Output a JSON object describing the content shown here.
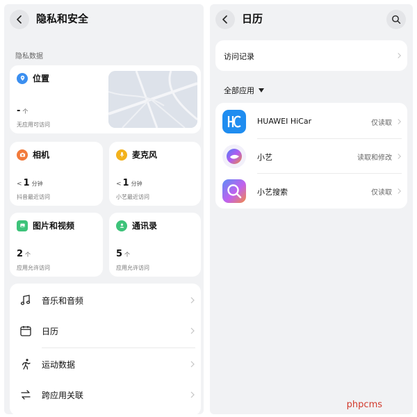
{
  "left": {
    "title": "隐私和安全",
    "section_label": "隐私数据",
    "location": {
      "title": "位置",
      "count": "-",
      "unit": "个",
      "desc": "无应用可访问"
    },
    "camera": {
      "title": "相机",
      "prefix": "<",
      "count": "1",
      "unit": "分钟",
      "desc": "抖音最近访问"
    },
    "microphone": {
      "title": "麦克风",
      "prefix": "<",
      "count": "1",
      "unit": "分钟",
      "desc": "小艺最近访问"
    },
    "photos": {
      "title": "图片和视频",
      "count": "2",
      "unit": "个",
      "desc": "应用允许访问"
    },
    "contacts": {
      "title": "通讯录",
      "count": "5",
      "unit": "个",
      "desc": "应用允许访问"
    },
    "list": [
      {
        "label": "音乐和音频",
        "icon": "music-note-icon"
      },
      {
        "label": "日历",
        "icon": "calendar-icon"
      },
      {
        "label": "运动数据",
        "icon": "running-icon"
      },
      {
        "label": "跨应用关联",
        "icon": "cross-app-icon"
      }
    ]
  },
  "right": {
    "title": "日历",
    "visit_label": "访问记录",
    "all_apps_label": "全部应用",
    "apps": [
      {
        "name": "HUAWEI HiCar",
        "perm": "仅读取",
        "icon": "hicar-icon"
      },
      {
        "name": "小艺",
        "perm": "读取和修改",
        "icon": "xiaoyi-icon"
      },
      {
        "name": "小艺搜索",
        "perm": "仅读取",
        "icon": "xiaoyi-search-icon"
      }
    ]
  },
  "watermark": "phpcms",
  "colors": {
    "location": "#3b8ff0",
    "camera": "#f27a3b",
    "microphone": "#f3b21c",
    "photos": "#3ec37a",
    "contacts": "#3ec37a",
    "hicar": "#1f8df0",
    "watermark": "#d23a2c"
  }
}
